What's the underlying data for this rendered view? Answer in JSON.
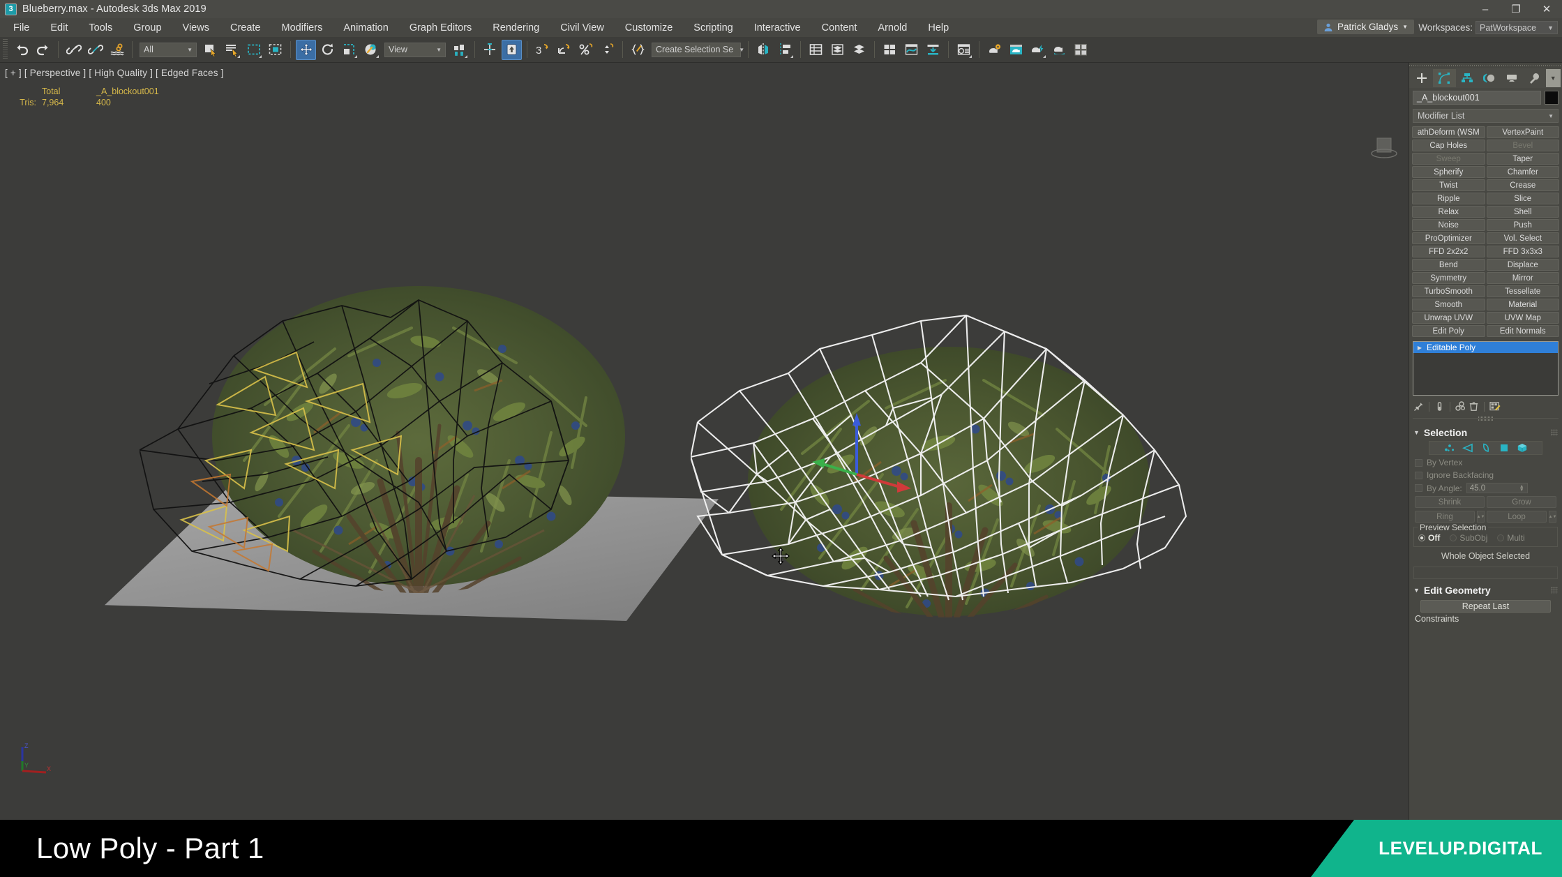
{
  "window": {
    "title": "Blueberry.max - Autodesk 3ds Max 2019",
    "app_icon": "3dsmax-icon",
    "minimize": "–",
    "maximize": "❐",
    "close": "✕"
  },
  "menubar": {
    "items": [
      {
        "label": "File"
      },
      {
        "label": "Edit"
      },
      {
        "label": "Tools"
      },
      {
        "label": "Group"
      },
      {
        "label": "Views"
      },
      {
        "label": "Create"
      },
      {
        "label": "Modifiers"
      },
      {
        "label": "Animation"
      },
      {
        "label": "Graph Editors"
      },
      {
        "label": "Rendering"
      },
      {
        "label": "Civil View"
      },
      {
        "label": "Customize"
      },
      {
        "label": "Scripting"
      },
      {
        "label": "Interactive"
      },
      {
        "label": "Content"
      },
      {
        "label": "Arnold"
      },
      {
        "label": "Help"
      }
    ],
    "user_name": "Patrick Gladys",
    "workspaces_label": "Workspaces:",
    "workspace_value": "PatWorkspace"
  },
  "toolbar": {
    "selection_filter_value": "All",
    "reference_coord_value": "View",
    "named_selection_value": "Create Selection Se",
    "buttons": [
      {
        "name": "undo-button",
        "tip": "Undo"
      },
      {
        "name": "redo-button",
        "tip": "Redo"
      },
      {
        "name": "select-link-button",
        "tip": "Select and Link"
      },
      {
        "name": "unlink-selection-button",
        "tip": "Unlink Selection"
      },
      {
        "name": "bind-space-warp-button",
        "tip": "Bind to Space Warp"
      },
      {
        "name": "select-object-button",
        "tip": "Select Object"
      },
      {
        "name": "select-by-name-button",
        "tip": "Select by Name"
      },
      {
        "name": "rectangular-select-region-button",
        "tip": "Rectangular Selection Region"
      },
      {
        "name": "window-crossing-button",
        "tip": "Window/Crossing"
      },
      {
        "name": "select-and-move-button",
        "tip": "Select and Move"
      },
      {
        "name": "select-and-rotate-button",
        "tip": "Select and Rotate"
      },
      {
        "name": "select-and-scale-button",
        "tip": "Select and Uniform Scale"
      },
      {
        "name": "select-and-place-button",
        "tip": "Select and Place"
      },
      {
        "name": "use-center-flyout-button",
        "tip": "Use Pivot Point Center"
      },
      {
        "name": "select-and-manipulate-button",
        "tip": "Select and Manipulate"
      },
      {
        "name": "snaps-toggle-button",
        "tip": "Snaps Toggle"
      },
      {
        "name": "angle-snap-button",
        "tip": "Angle Snap Toggle"
      },
      {
        "name": "percent-snap-button",
        "tip": "Percent Snap Toggle"
      },
      {
        "name": "spinner-snap-button",
        "tip": "Spinner Snap Toggle"
      },
      {
        "name": "edit-named-selection-button",
        "tip": "Edit Named Selection Sets"
      },
      {
        "name": "mirror-button",
        "tip": "Mirror"
      },
      {
        "name": "align-flyout-button",
        "tip": "Align"
      },
      {
        "name": "layer-explorer-button",
        "tip": "Toggle Scene Explorer"
      },
      {
        "name": "layer-manager-button",
        "tip": "Toggle Layer Explorer"
      },
      {
        "name": "ribbon-button",
        "tip": "Toggle Ribbon"
      },
      {
        "name": "curve-editor-button",
        "tip": "Curve Editor"
      },
      {
        "name": "schematic-view-button",
        "tip": "Schematic View"
      },
      {
        "name": "material-editor-button",
        "tip": "Material Editor"
      },
      {
        "name": "render-setup-button",
        "tip": "Render Setup"
      },
      {
        "name": "rendered-frame-window-button",
        "tip": "Rendered Frame Window"
      },
      {
        "name": "render-production-button",
        "tip": "Render Production"
      },
      {
        "name": "render-iterative-button",
        "tip": "Render Iterative"
      },
      {
        "name": "render-in-cloud-button",
        "tip": "Render in Cloud"
      },
      {
        "name": "open-atf-button",
        "tip": "Project Folder"
      }
    ]
  },
  "viewport": {
    "label": "[ + ] [ Perspective ] [ High Quality ] [ Edged Faces ]",
    "stats": {
      "col_headers": [
        "",
        "Total",
        "_A_blockout001"
      ],
      "rows": [
        {
          "label": "Tris:",
          "total": "7,964",
          "object": "400"
        }
      ]
    },
    "axis_labels": [
      "Z",
      "Y",
      "X"
    ],
    "cursor": "move-cursor"
  },
  "command_panel": {
    "tabs": [
      {
        "name": "create-tab",
        "icon": "plus-icon",
        "selected": false
      },
      {
        "name": "modify-tab",
        "icon": "modify-icon",
        "selected": true
      },
      {
        "name": "hierarchy-tab",
        "icon": "hierarchy-icon",
        "selected": false
      },
      {
        "name": "motion-tab",
        "icon": "motion-icon",
        "selected": false
      },
      {
        "name": "display-tab",
        "icon": "display-icon",
        "selected": false
      },
      {
        "name": "utilities-tab",
        "icon": "utilities-icon",
        "selected": false
      }
    ],
    "object_name": "_A_blockout001",
    "modifier_list_label": "Modifier List",
    "modifier_buttons": [
      {
        "label": "athDeform (WSM",
        "disabled": false
      },
      {
        "label": "VertexPaint",
        "disabled": false
      },
      {
        "label": "Cap Holes",
        "disabled": false
      },
      {
        "label": "Bevel",
        "disabled": true
      },
      {
        "label": "Sweep",
        "disabled": true
      },
      {
        "label": "Taper",
        "disabled": false
      },
      {
        "label": "Spherify",
        "disabled": false
      },
      {
        "label": "Chamfer",
        "disabled": false
      },
      {
        "label": "Twist",
        "disabled": false
      },
      {
        "label": "Crease",
        "disabled": false
      },
      {
        "label": "Ripple",
        "disabled": false
      },
      {
        "label": "Slice",
        "disabled": false
      },
      {
        "label": "Relax",
        "disabled": false
      },
      {
        "label": "Shell",
        "disabled": false
      },
      {
        "label": "Noise",
        "disabled": false
      },
      {
        "label": "Push",
        "disabled": false
      },
      {
        "label": "ProOptimizer",
        "disabled": false
      },
      {
        "label": "Vol. Select",
        "disabled": false
      },
      {
        "label": "FFD 2x2x2",
        "disabled": false
      },
      {
        "label": "FFD 3x3x3",
        "disabled": false
      },
      {
        "label": "Bend",
        "disabled": false
      },
      {
        "label": "Displace",
        "disabled": false
      },
      {
        "label": "Symmetry",
        "disabled": false
      },
      {
        "label": "Mirror",
        "disabled": false
      },
      {
        "label": "TurboSmooth",
        "disabled": false
      },
      {
        "label": "Tessellate",
        "disabled": false
      },
      {
        "label": "Smooth",
        "disabled": false
      },
      {
        "label": "Material",
        "disabled": false
      },
      {
        "label": "Unwrap UVW",
        "disabled": false
      },
      {
        "label": "UVW Map",
        "disabled": false
      },
      {
        "label": "Edit Poly",
        "disabled": false
      },
      {
        "label": "Edit Normals",
        "disabled": false
      }
    ],
    "modifier_stack": [
      {
        "label": "Editable Poly",
        "selected": true
      }
    ],
    "stack_tools": [
      {
        "name": "pin-stack-icon"
      },
      {
        "name": "show-end-result-icon"
      },
      {
        "name": "make-unique-icon"
      },
      {
        "name": "remove-modifier-icon"
      },
      {
        "name": "configure-modifier-sets-icon"
      }
    ],
    "selection_rollout": {
      "title": "Selection",
      "sub_object_levels": [
        {
          "name": "vertex-subobject",
          "label": "Vertex"
        },
        {
          "name": "edge-subobject",
          "label": "Edge"
        },
        {
          "name": "border-subobject",
          "label": "Border"
        },
        {
          "name": "polygon-subobject",
          "label": "Polygon"
        },
        {
          "name": "element-subobject",
          "label": "Element"
        }
      ],
      "by_vertex_label": "By Vertex",
      "ignore_backfacing_label": "Ignore Backfacing",
      "by_angle_label": "By Angle:",
      "by_angle_value": "45.0",
      "shrink_label": "Shrink",
      "grow_label": "Grow",
      "ring_label": "Ring",
      "loop_label": "Loop",
      "preview_selection_label": "Preview Selection",
      "preview_options": [
        {
          "label": "Off",
          "selected": true
        },
        {
          "label": "SubObj",
          "selected": false
        },
        {
          "label": "Multi",
          "selected": false
        }
      ],
      "status": "Whole Object Selected"
    },
    "edit_geometry_rollout": {
      "title": "Edit Geometry",
      "repeat_last_label": "Repeat Last",
      "constraints_label": "Constraints"
    }
  },
  "banner": {
    "title": "Low Poly - Part 1",
    "brand": "LEVELUP.DIGITAL",
    "brand_color": "#10b48c"
  },
  "colors": {
    "window_bg": "#3a3a38",
    "titlebar": "#4a4a46",
    "toolbar": "#3d3d3a",
    "viewport": "#3c3c3a",
    "panel": "#474742",
    "accent_blue": "#2f7fd8",
    "accent_teal": "#29b4c4",
    "stat_text": "#d6b84a"
  }
}
